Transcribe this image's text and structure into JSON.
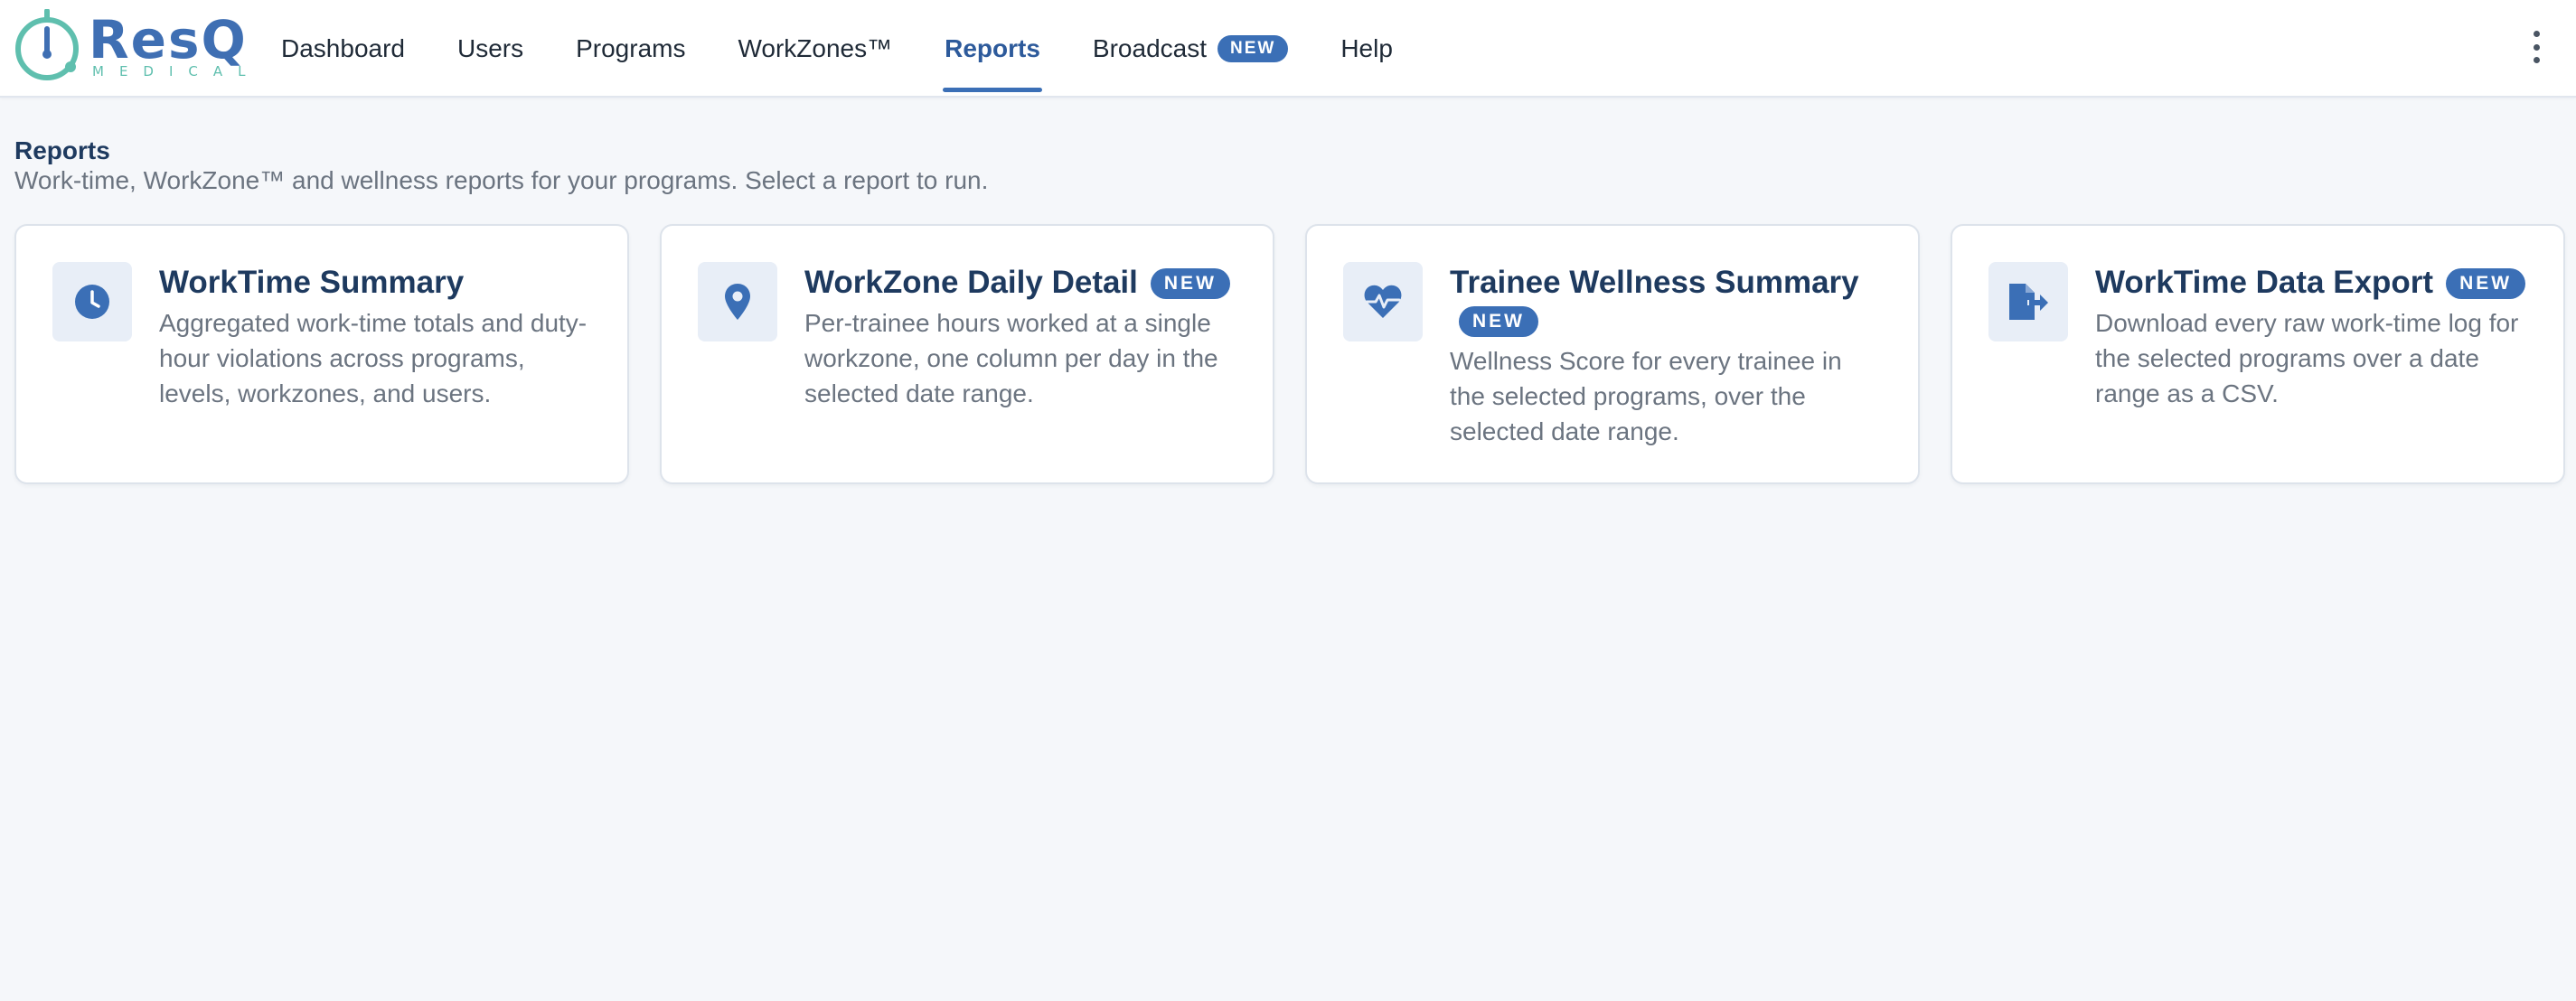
{
  "logo": {
    "name": "ResQ",
    "sub": "MEDICAL",
    "colors": {
      "primary": "#3f6fb3",
      "accent": "#5fbfae"
    }
  },
  "nav": {
    "items": [
      {
        "label": "Dashboard"
      },
      {
        "label": "Users"
      },
      {
        "label": "Programs"
      },
      {
        "label": "WorkZones™"
      },
      {
        "label": "Reports",
        "active": true
      },
      {
        "label": "Broadcast",
        "badge": "NEW"
      },
      {
        "label": "Help"
      }
    ],
    "menu_icon": "kebab-vertical-icon"
  },
  "page": {
    "title": "Reports",
    "subtitle": "Work-time, WorkZone™ and wellness reports for your programs. Select a report to run."
  },
  "reports": [
    {
      "icon": "clock-icon",
      "title": "WorkTime Summary",
      "badge": "",
      "description": "Aggregated work-time totals and duty-hour violations across programs, levels, workzones, and users."
    },
    {
      "icon": "map-pin-icon",
      "title": "WorkZone Daily Detail",
      "badge": "NEW",
      "description": "Per-trainee hours worked at a single workzone, one column per day in the selected date range."
    },
    {
      "icon": "heart-pulse-icon",
      "title": "Trainee Wellness Summary",
      "badge": "NEW",
      "description": "Wellness Score for every trainee in the selected programs, over the selected date range."
    },
    {
      "icon": "file-export-icon",
      "title": "WorkTime Data Export",
      "badge": "NEW",
      "description": "Download every raw work-time log for the selected programs over a date range as a CSV."
    }
  ],
  "colors": {
    "accent": "#3b6fb6",
    "title": "#1e3a5f",
    "muted": "#6b7480",
    "background": "#f5f7fa"
  }
}
